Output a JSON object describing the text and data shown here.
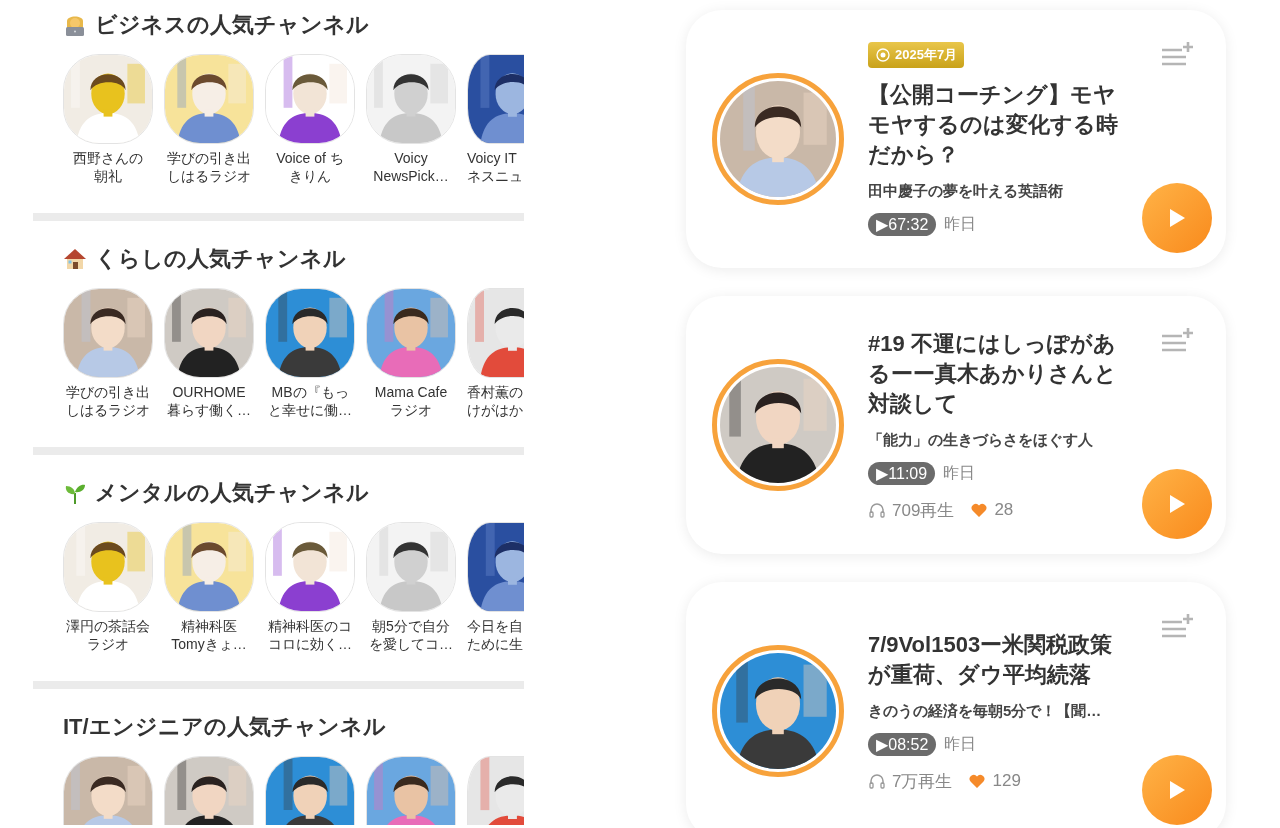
{
  "sections": [
    {
      "title": "ビジネスの人気チャンネル",
      "channels": [
        {
          "lines": [
            "西野さんの",
            "朝礼"
          ]
        },
        {
          "lines": [
            "学びの引き出",
            "しはるラジオ"
          ]
        },
        {
          "lines": [
            "Voice of ち",
            "きりん"
          ]
        },
        {
          "lines": [
            "Voicy",
            "NewsPick…"
          ]
        },
        {
          "lines": [
            "Voicy IT",
            "ネスニュ"
          ]
        }
      ]
    },
    {
      "title": "くらしの人気チャンネル",
      "channels": [
        {
          "lines": [
            "学びの引き出",
            "しはるラジオ"
          ]
        },
        {
          "lines": [
            "OURHOME",
            "暮らす働く…"
          ]
        },
        {
          "lines": [
            "MBの『もっ",
            "と幸せに働…"
          ]
        },
        {
          "lines": [
            "Mama Cafe",
            "ラジオ"
          ]
        },
        {
          "lines": [
            "香村薫の",
            "けがはか"
          ]
        }
      ]
    },
    {
      "title": "メンタルの人気チャンネル",
      "channels": [
        {
          "lines": [
            "澤円の茶話会",
            "ラジオ"
          ]
        },
        {
          "lines": [
            "精神科医",
            "Tomyきょ…"
          ]
        },
        {
          "lines": [
            "精神科医のコ",
            "コロに効く…"
          ]
        },
        {
          "lines": [
            "朝5分で自分",
            "を愛してコ…"
          ]
        },
        {
          "lines": [
            "今日を自",
            "ために生"
          ]
        }
      ]
    },
    {
      "title": "IT/エンジニアの人気チャンネル"
    }
  ],
  "episodes": [
    {
      "badge": "2025年7月",
      "title": "【公開コーチング】モヤモヤするのは変化する時だから？",
      "channel": "田中慶子の夢を叶える英語術",
      "duration": "▶67:32",
      "date": "昨日"
    },
    {
      "title": "#19 不運にはしっぽがあるーー真木あかりさんと対談して",
      "channel": "「能力」の生きづらさをほぐす人",
      "duration": "▶11:09",
      "date": "昨日",
      "plays": "709再生",
      "likes": "28"
    },
    {
      "title": "7/9Vol1503ー米関税政策が重荷、ダウ平均続落",
      "channel": "きのうの経済を毎朝5分で！【聞…",
      "duration": "▶08:52",
      "date": "昨日",
      "plays": "7万再生",
      "likes": "129"
    }
  ]
}
